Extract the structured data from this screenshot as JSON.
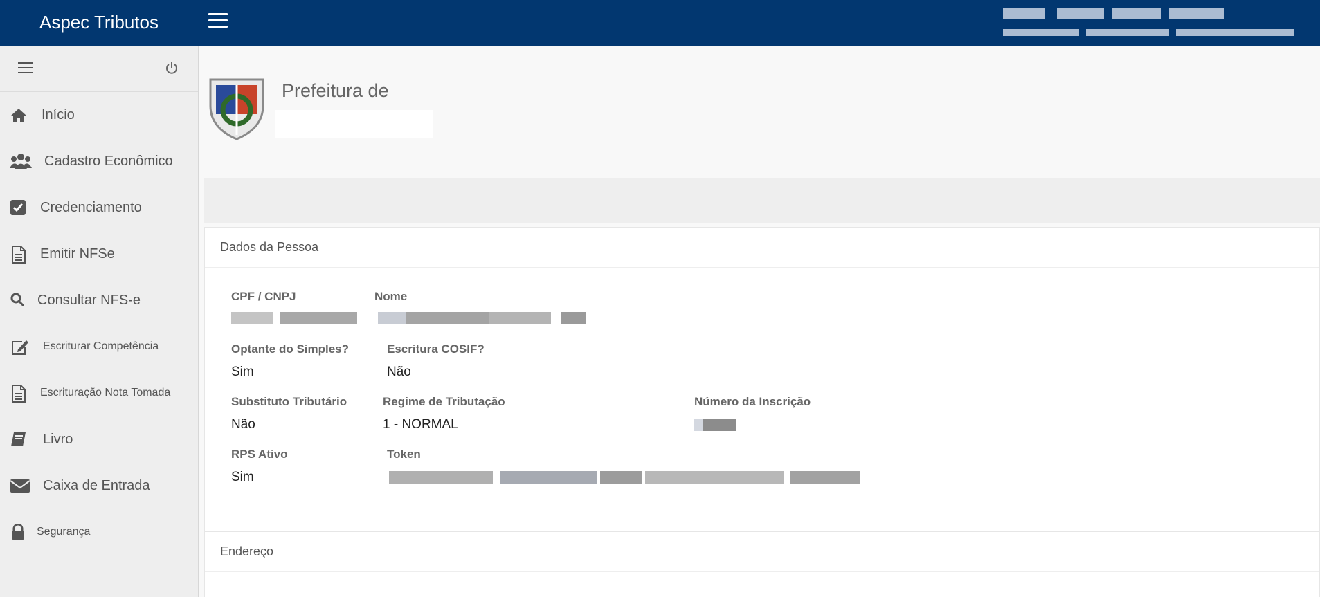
{
  "navbar": {
    "brand": "Aspec Tributos",
    "bg_color": "#023770"
  },
  "sidebar": {
    "items": [
      {
        "label": "Início",
        "icon": "home-icon"
      },
      {
        "label": "Cadastro Econômico",
        "icon": "users-icon"
      },
      {
        "label": "Credenciamento",
        "icon": "check-square-icon"
      },
      {
        "label": "Emitir NFSe",
        "icon": "document-icon"
      },
      {
        "label": "Consultar NFS-e",
        "icon": "search-icon"
      },
      {
        "label": "Escriturar Competência",
        "icon": "edit-icon"
      },
      {
        "label": "Escrituração Nota Tomada",
        "icon": "document-icon"
      },
      {
        "label": "Livro",
        "icon": "book-icon"
      },
      {
        "label": "Caixa de Entrada",
        "icon": "envelope-icon"
      },
      {
        "label": "Segurança",
        "icon": "lock-icon"
      }
    ]
  },
  "header": {
    "title": "Prefeitura de"
  },
  "dados_pessoa": {
    "title": "Dados da Pessoa",
    "cpf_cnpj_label": "CPF / CNPJ",
    "nome_label": "Nome",
    "optante_label": "Optante do Simples?",
    "optante_value": "Sim",
    "cosif_label": "Escritura COSIF?",
    "cosif_value": "Não",
    "substituto_label": "Substituto Tributário",
    "substituto_value": "Não",
    "regime_label": "Regime de Tributação",
    "regime_value": "1 - NORMAL",
    "inscricao_label": "Número da Inscrição",
    "rps_label": "RPS Ativo",
    "rps_value": "Sim",
    "token_label": "Token"
  },
  "endereco": {
    "title": "Endereço"
  }
}
